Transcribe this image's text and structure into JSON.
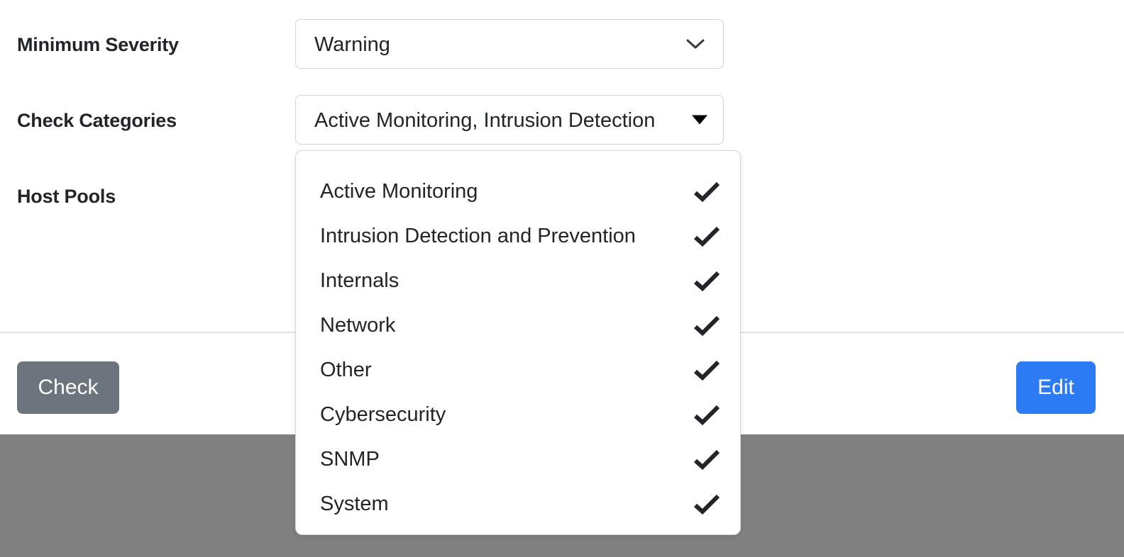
{
  "form": {
    "fields": [
      {
        "label": "Minimum Severity",
        "control": "select",
        "value": "Warning",
        "icon": "chevron-down-icon"
      },
      {
        "label": "Check Categories",
        "control": "multiselect",
        "value": "Active Monitoring, Intrusion Detection",
        "icon": "caret-down-icon"
      },
      {
        "label": "Host Pools",
        "control": "multiselect",
        "value": "",
        "icon": "caret-down-icon"
      }
    ]
  },
  "dropdown": {
    "name": "check-categories-dropdown",
    "open": true,
    "items": [
      {
        "label": "Active Monitoring",
        "checked": true,
        "check_glyph": "✔"
      },
      {
        "label": "Intrusion Detection and Prevention",
        "checked": true,
        "check_glyph": "✔"
      },
      {
        "label": "Internals",
        "checked": true,
        "check_glyph": "✔"
      },
      {
        "label": "Network",
        "checked": true,
        "check_glyph": "✔"
      },
      {
        "label": "Other",
        "checked": true,
        "check_glyph": "✔"
      },
      {
        "label": "Cybersecurity",
        "checked": true,
        "check_glyph": "✔"
      },
      {
        "label": "SNMP",
        "checked": true,
        "check_glyph": "✔"
      },
      {
        "label": "System",
        "checked": true,
        "check_glyph": "✔"
      }
    ]
  },
  "footer": {
    "check_label": "Check",
    "edit_label": "Edit"
  },
  "colors": {
    "primary_button": "#2d7bf4",
    "secondary_button": "#6c757d",
    "label_text": "#212529",
    "border": "#ced4da",
    "divider": "#dee2e6",
    "backdrop": "#808080",
    "check_mark": "#212529"
  }
}
